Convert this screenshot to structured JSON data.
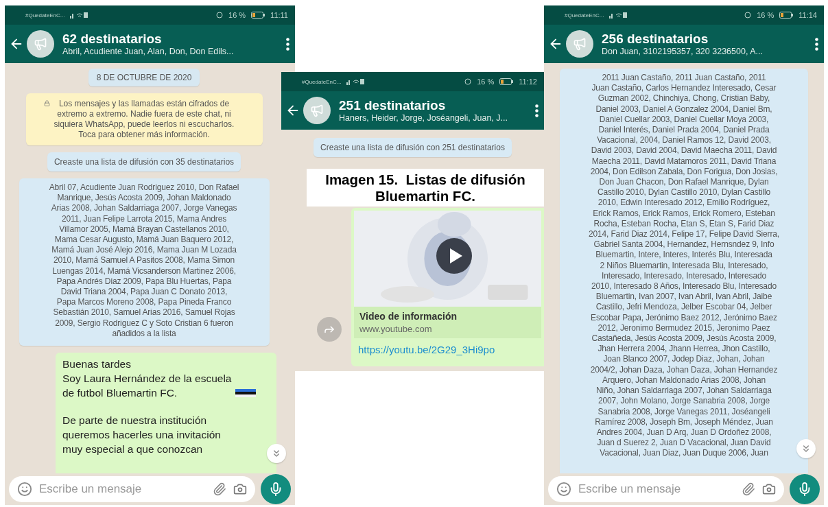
{
  "caption": "Imagen 15.  Listas de difusión Bluemartin FC.",
  "screens": [
    {
      "status_bar": {
        "carrier": "#QuedateEnC...",
        "battery": "16 %",
        "time": "11:11"
      },
      "header": {
        "title": "62 destinatarios",
        "subtitle": "Abril, Acudiente Juan, Alan, Don, Don Edils..."
      },
      "messages": [
        {
          "kind": "date",
          "text": "8 DE OCTUBRE DE 2020"
        },
        {
          "kind": "encryption",
          "text": "Los mensajes y las llamadas están cifrados de\nextremo a extremo. Nadie fuera de este chat, ni\nsiquiera WhatsApp, puede leerlos ni escucharlos.\nToca para obtener más información."
        },
        {
          "kind": "system",
          "text": "Creaste una lista de difusión con 35 destinatarios"
        },
        {
          "kind": "names",
          "text": "Abril 07, Acudiente Juan Rodriguez 2010, Don Rafael\nManrique, Jesús Acosta 2009, Johan Maldonado\nArias 2008, Johan Saldarriaga 2007, Jorge Vanegas\n2011, Juan Felipe Larrota 2015, Mama Andres\nVillamor 2005, Mamá Brayan Castellanos 2010,\nMama Cesar Augusto, Mamá Juan Baquero 2012,\nMamá Juan José Alejo 2016, Mama Juan M Lozada\n2010, Mamá Samuel A Pasitos 2008, Mama Simon\nLuengas 2014, Mamá Vicsanderson Martinez 2006,\nPapa Andrés Diaz 2009, Papa Blu Huertas, Papa\nDavid Triana 2004, Papa Juan C Donato 2013,\nPapa Marcos Moreno 2008, Papa Pineda Franco\nSebastián 2010, Samuel Arias 2016, Samuel Rojas\n2009, Sergio Rodriguez C y Soto Cristian 6 fueron\nañadidos a la lista"
        },
        {
          "kind": "sent",
          "paragraphs": [
            {
              "kind": "flag",
              "text": "Buenas tardes\nSoy Laura Hernández de la escuela\nde futbol Bluemartin FC."
            },
            {
              "kind": "text",
              "text": "De parte de nuestra institución\nqueremos hacerles una invitación\nmuy especial a que conozcan"
            }
          ]
        }
      ],
      "composer": {
        "placeholder": "Escribe un mensaje"
      }
    },
    {
      "status_bar": {
        "carrier": "#QuedateEnC...",
        "battery": "16 %",
        "time": "11:12"
      },
      "header": {
        "title": "251 destinatarios",
        "subtitle": "Haners, Heider, Jorge, Joséangeli, Juan, J..."
      },
      "messages": [
        {
          "kind": "system",
          "text": "Creaste una lista de difusión con 251 destinatarios"
        },
        {
          "kind": "link_preview",
          "title": "Video de información",
          "domain": "www.youtube.com",
          "url": "https://youtu.be/2G29_3Hi9po"
        }
      ]
    },
    {
      "status_bar": {
        "carrier": "#QuedateEnC...",
        "battery": "16 %",
        "time": "11:14"
      },
      "header": {
        "title": "256 destinatarios",
        "subtitle": "Don Juan, 3102195357, 320 3236500, A..."
      },
      "messages": [
        {
          "kind": "names",
          "text": "2011 Juan Castaño, 2011 Juan Castaño, 2011\nJuan Castaño, Carlos Hernandez Interesado, Cesar\nGuzman 2002, Chinchiya, Chong, Cristian Baby,\nDaniel 2003, Daniel A Gonzalez 2004, Daniel Bm,\nDaniel Cuellar 2003, Daniel Cuellar Moya 2003,\nDaniel Interés, Daniel Prada 2004, Daniel Prada\nVacacional, 2004, Daniel Ramos 12, David 2003,\nDavid 2003, David 2004, David Maecha 2011, David\nMaecha 2011, David Matamoros 2011, David Triana\n2004, Don Edilson Zabala, Don Forigua, Don Josias,\nDon Juan Chacon, Don Rafael Manrique, Dylan\nCastillo 2010, Dylan Castillo 2010, Dylan Castillo\n2010, Edwin Interesado 2012, Emilio Rodríguez,\nErick Ramos, Erick Ramos, Erick Romero, Esteban\nRocha, Esteban Rocha, Etan S, Etan S, Farid Diaz\n2014, Farid Diaz 2014, Felipe 17, Felipe David Sierra,\nGabriel Santa 2004, Hernandez, Hernsndez 9, Info\nBluemartin, Intere, Interes, Interés Blu, Interesada\n2 Niños Bluemartin, Interesada Blu, Interesado,\nInteresado, Interesado, Interesado, Interesado\n2010, Interesado 8 Años, Interesado Blu, Interesado\nBluemartin, Ivan 2007, Ivan Abril, Ivan Abril, Jaibe\nCastillo, Jefri Mendoza, Jelber Escobar 04, Jelber\nEscobar Papa, Jerónimo Baez 2012, Jerónimo Baez\n2012, Jeronimo Bermudez 2015, Jeronimo Paez\nCastañeda, Jesús Acosta 2009, Jesús Acosta 2009,\nJhan Herrera 2004, Jhann Herrea, Jhon Castillo,\nJoan Blanco 2007, Jodep Diaz, Johan, Johan\n2004/2, Johan Daza, Johan Daza, Johan Hernandez\nArquero, Johan Maldonado Arias 2008, Johan\nNiño, Johan Saldarriaga 2007, Johan Saldarriaga\n2007, John Molano, Jorge Sanabria 2008, Jorge\nSanabria 2008, Jorge Vanegas 2011, Joséangeli\nRamírez 2008, Joseph Bm, Joseph Méndez, Juan\nAndres 2004, Juan D Arq, Juan D Ordoñez 2008,\nJuan d Suerez 2, Juan D Vacacional, Juan David\nVacacional, Juan Diaz, Juan Duque 2006, Juan"
        }
      ],
      "composer": {
        "placeholder": "Escribe un mensaje"
      }
    }
  ]
}
